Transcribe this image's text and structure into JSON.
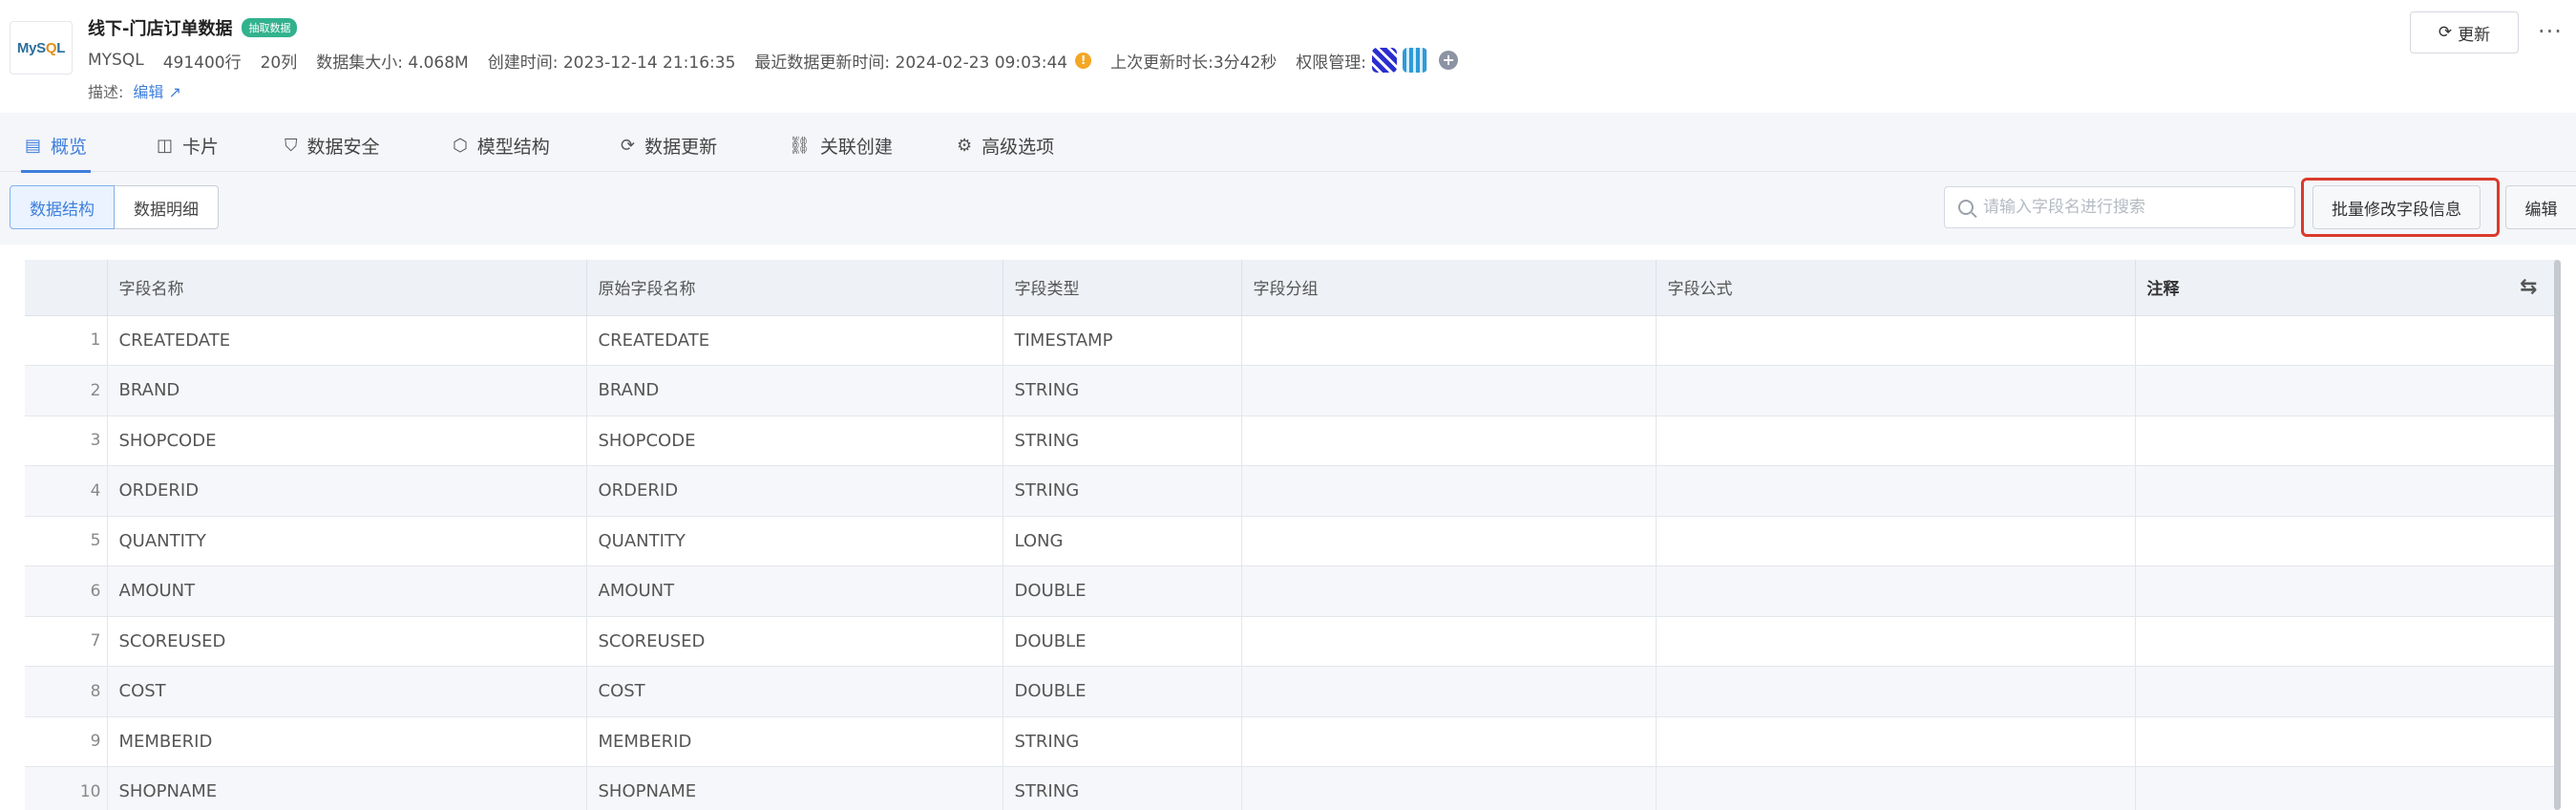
{
  "header": {
    "logo_text_my": "My",
    "logo_text_s": "S",
    "logo_text_q": "Q",
    "logo_text_l": "L",
    "title": "线下-门店订单数据",
    "tag": "抽取数据",
    "db_type": "MYSQL",
    "rows": "491400行",
    "cols": "20列",
    "size_label": "数据集大小: 4.068M",
    "created_label": "创建时间: 2023-12-14 21:16:35",
    "last_update_label": "最近数据更新时间: 2024-02-23 09:03:44",
    "duration_label": "上次更新时长:3分42秒",
    "permission_label": "权限管理:",
    "desc_label": "描述:",
    "desc_edit": "编辑",
    "update_button": "更新"
  },
  "tabs": [
    {
      "label": "概览",
      "icon": "overview-icon",
      "active": true
    },
    {
      "label": "卡片",
      "icon": "card-icon"
    },
    {
      "label": "数据安全",
      "icon": "shield-icon"
    },
    {
      "label": "模型结构",
      "icon": "cube-icon"
    },
    {
      "label": "数据更新",
      "icon": "refresh-icon"
    },
    {
      "label": "关联创建",
      "icon": "link-icon"
    },
    {
      "label": "高级选项",
      "icon": "gear-icon"
    }
  ],
  "toolbar": {
    "view_structure": "数据结构",
    "view_detail": "数据明细",
    "search_placeholder": "请输入字段名进行搜索",
    "batch_button": "批量修改字段信息",
    "edit_button": "编辑"
  },
  "table": {
    "headers": [
      "字段名称",
      "原始字段名称",
      "字段类型",
      "字段分组",
      "字段公式",
      "注释"
    ],
    "rows": [
      {
        "n": "1",
        "name": "CREATEDATE",
        "orig": "CREATEDATE",
        "type": "TIMESTAMP"
      },
      {
        "n": "2",
        "name": "BRAND",
        "orig": "BRAND",
        "type": "STRING"
      },
      {
        "n": "3",
        "name": "SHOPCODE",
        "orig": "SHOPCODE",
        "type": "STRING"
      },
      {
        "n": "4",
        "name": "ORDERID",
        "orig": "ORDERID",
        "type": "STRING"
      },
      {
        "n": "5",
        "name": "QUANTITY",
        "orig": "QUANTITY",
        "type": "LONG"
      },
      {
        "n": "6",
        "name": "AMOUNT",
        "orig": "AMOUNT",
        "type": "DOUBLE"
      },
      {
        "n": "7",
        "name": "SCOREUSED",
        "orig": "SCOREUSED",
        "type": "DOUBLE"
      },
      {
        "n": "8",
        "name": "COST",
        "orig": "COST",
        "type": "DOUBLE"
      },
      {
        "n": "9",
        "name": "MEMBERID",
        "orig": "MEMBERID",
        "type": "STRING"
      },
      {
        "n": "10",
        "name": "SHOPNAME",
        "orig": "SHOPNAME",
        "type": "STRING"
      }
    ]
  },
  "colors": {
    "accent": "#3f7fdb",
    "tag": "#31b28d",
    "highlight": "#d93a2b",
    "warn": "#f5a623"
  }
}
